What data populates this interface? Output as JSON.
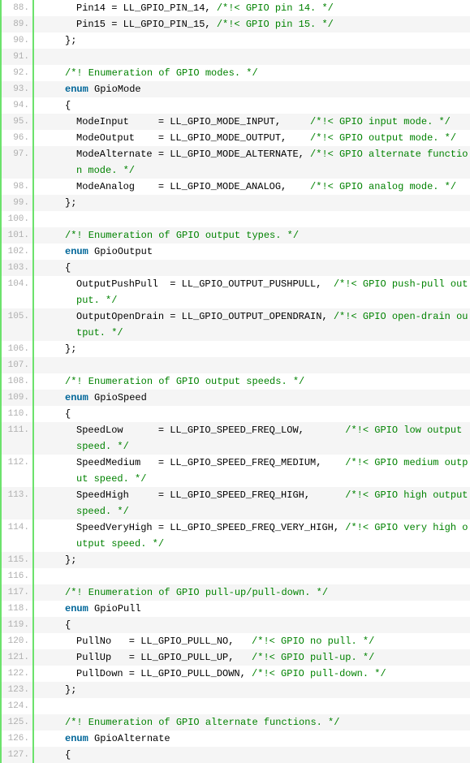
{
  "lines": [
    {
      "n": "88.",
      "indent": 6,
      "tokens": [
        {
          "c": "plain",
          "t": "Pin14 = LL_GPIO_PIN_14, "
        },
        {
          "c": "cmt",
          "t": "/*!< GPIO pin 14. */"
        }
      ]
    },
    {
      "n": "89.",
      "indent": 6,
      "tokens": [
        {
          "c": "plain",
          "t": "Pin15 = LL_GPIO_PIN_15, "
        },
        {
          "c": "cmt",
          "t": "/*!< GPIO pin 15. */"
        }
      ]
    },
    {
      "n": "90.",
      "indent": 4,
      "tokens": [
        {
          "c": "plain",
          "t": "};"
        }
      ]
    },
    {
      "n": "91.",
      "indent": 0,
      "tokens": []
    },
    {
      "n": "92.",
      "indent": 4,
      "tokens": [
        {
          "c": "cmt",
          "t": "/*! Enumeration of GPIO modes. */"
        }
      ]
    },
    {
      "n": "93.",
      "indent": 4,
      "tokens": [
        {
          "c": "kw",
          "t": "enum"
        },
        {
          "c": "plain",
          "t": " GpioMode"
        }
      ]
    },
    {
      "n": "94.",
      "indent": 4,
      "tokens": [
        {
          "c": "plain",
          "t": "{"
        }
      ]
    },
    {
      "n": "95.",
      "indent": 6,
      "tokens": [
        {
          "c": "plain",
          "t": "ModeInput     = LL_GPIO_MODE_INPUT,     "
        },
        {
          "c": "cmt",
          "t": "/*!< GPIO input mode. */"
        }
      ]
    },
    {
      "n": "96.",
      "indent": 6,
      "tokens": [
        {
          "c": "plain",
          "t": "ModeOutput    = LL_GPIO_MODE_OUTPUT,    "
        },
        {
          "c": "cmt",
          "t": "/*!< GPIO output mode. */"
        }
      ]
    },
    {
      "n": "97.",
      "indent": 6,
      "tokens": [
        {
          "c": "plain",
          "t": "ModeAlternate = LL_GPIO_MODE_ALTERNATE, "
        },
        {
          "c": "cmt",
          "t": "/*!< GPIO alternate function mode. */"
        }
      ]
    },
    {
      "n": "98.",
      "indent": 6,
      "tokens": [
        {
          "c": "plain",
          "t": "ModeAnalog    = LL_GPIO_MODE_ANALOG,    "
        },
        {
          "c": "cmt",
          "t": "/*!< GPIO analog mode. */"
        }
      ]
    },
    {
      "n": "99.",
      "indent": 4,
      "tokens": [
        {
          "c": "plain",
          "t": "};"
        }
      ]
    },
    {
      "n": "100.",
      "indent": 0,
      "tokens": []
    },
    {
      "n": "101.",
      "indent": 4,
      "tokens": [
        {
          "c": "cmt",
          "t": "/*! Enumeration of GPIO output types. */"
        }
      ]
    },
    {
      "n": "102.",
      "indent": 4,
      "tokens": [
        {
          "c": "kw",
          "t": "enum"
        },
        {
          "c": "plain",
          "t": " GpioOutput"
        }
      ]
    },
    {
      "n": "103.",
      "indent": 4,
      "tokens": [
        {
          "c": "plain",
          "t": "{"
        }
      ]
    },
    {
      "n": "104.",
      "indent": 6,
      "tokens": [
        {
          "c": "plain",
          "t": "OutputPushPull  = LL_GPIO_OUTPUT_PUSHPULL,  "
        },
        {
          "c": "cmt",
          "t": "/*!< GPIO push-pull output. */"
        }
      ]
    },
    {
      "n": "105.",
      "indent": 6,
      "tokens": [
        {
          "c": "plain",
          "t": "OutputOpenDrain = LL_GPIO_OUTPUT_OPENDRAIN, "
        },
        {
          "c": "cmt",
          "t": "/*!< GPIO open-drain output. */"
        }
      ]
    },
    {
      "n": "106.",
      "indent": 4,
      "tokens": [
        {
          "c": "plain",
          "t": "};"
        }
      ]
    },
    {
      "n": "107.",
      "indent": 0,
      "tokens": []
    },
    {
      "n": "108.",
      "indent": 4,
      "tokens": [
        {
          "c": "cmt",
          "t": "/*! Enumeration of GPIO output speeds. */"
        }
      ]
    },
    {
      "n": "109.",
      "indent": 4,
      "tokens": [
        {
          "c": "kw",
          "t": "enum"
        },
        {
          "c": "plain",
          "t": " GpioSpeed"
        }
      ]
    },
    {
      "n": "110.",
      "indent": 4,
      "tokens": [
        {
          "c": "plain",
          "t": "{"
        }
      ]
    },
    {
      "n": "111.",
      "indent": 6,
      "tokens": [
        {
          "c": "plain",
          "t": "SpeedLow      = LL_GPIO_SPEED_FREQ_LOW,       "
        },
        {
          "c": "cmt",
          "t": "/*!< GPIO low output speed. */"
        }
      ]
    },
    {
      "n": "112.",
      "indent": 6,
      "tokens": [
        {
          "c": "plain",
          "t": "SpeedMedium   = LL_GPIO_SPEED_FREQ_MEDIUM,    "
        },
        {
          "c": "cmt",
          "t": "/*!< GPIO medium output speed. */"
        }
      ]
    },
    {
      "n": "113.",
      "indent": 6,
      "tokens": [
        {
          "c": "plain",
          "t": "SpeedHigh     = LL_GPIO_SPEED_FREQ_HIGH,      "
        },
        {
          "c": "cmt",
          "t": "/*!< GPIO high output speed. */"
        }
      ]
    },
    {
      "n": "114.",
      "indent": 6,
      "tokens": [
        {
          "c": "plain",
          "t": "SpeedVeryHigh = LL_GPIO_SPEED_FREQ_VERY_HIGH, "
        },
        {
          "c": "cmt",
          "t": "/*!< GPIO very high output speed. */"
        }
      ]
    },
    {
      "n": "115.",
      "indent": 4,
      "tokens": [
        {
          "c": "plain",
          "t": "};"
        }
      ]
    },
    {
      "n": "116.",
      "indent": 0,
      "tokens": []
    },
    {
      "n": "117.",
      "indent": 4,
      "tokens": [
        {
          "c": "cmt",
          "t": "/*! Enumeration of GPIO pull-up/pull-down. */"
        }
      ]
    },
    {
      "n": "118.",
      "indent": 4,
      "tokens": [
        {
          "c": "kw",
          "t": "enum"
        },
        {
          "c": "plain",
          "t": " GpioPull"
        }
      ]
    },
    {
      "n": "119.",
      "indent": 4,
      "tokens": [
        {
          "c": "plain",
          "t": "{"
        }
      ]
    },
    {
      "n": "120.",
      "indent": 6,
      "tokens": [
        {
          "c": "plain",
          "t": "PullNo   = LL_GPIO_PULL_NO,   "
        },
        {
          "c": "cmt",
          "t": "/*!< GPIO no pull. */"
        }
      ]
    },
    {
      "n": "121.",
      "indent": 6,
      "tokens": [
        {
          "c": "plain",
          "t": "PullUp   = LL_GPIO_PULL_UP,   "
        },
        {
          "c": "cmt",
          "t": "/*!< GPIO pull-up. */"
        }
      ]
    },
    {
      "n": "122.",
      "indent": 6,
      "tokens": [
        {
          "c": "plain",
          "t": "PullDown = LL_GPIO_PULL_DOWN, "
        },
        {
          "c": "cmt",
          "t": "/*!< GPIO pull-down. */"
        }
      ]
    },
    {
      "n": "123.",
      "indent": 4,
      "tokens": [
        {
          "c": "plain",
          "t": "};"
        }
      ]
    },
    {
      "n": "124.",
      "indent": 0,
      "tokens": []
    },
    {
      "n": "125.",
      "indent": 4,
      "tokens": [
        {
          "c": "cmt",
          "t": "/*! Enumeration of GPIO alternate functions. */"
        }
      ]
    },
    {
      "n": "126.",
      "indent": 4,
      "tokens": [
        {
          "c": "kw",
          "t": "enum"
        },
        {
          "c": "plain",
          "t": " GpioAlternate"
        }
      ]
    },
    {
      "n": "127.",
      "indent": 4,
      "tokens": [
        {
          "c": "plain",
          "t": "{"
        }
      ]
    }
  ]
}
